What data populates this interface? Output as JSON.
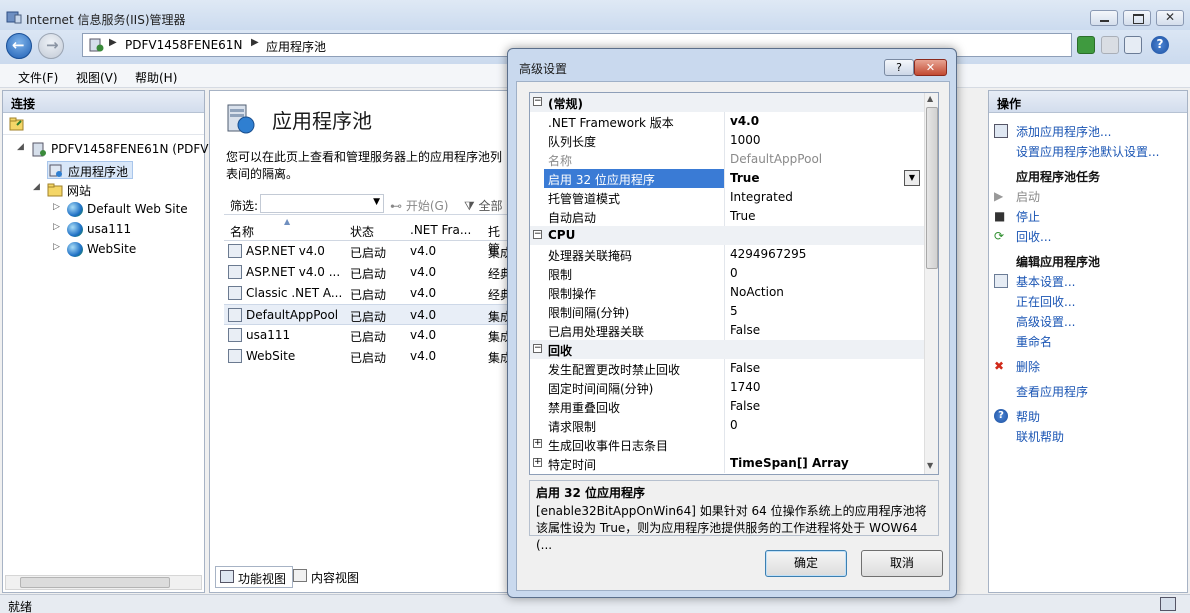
{
  "window": {
    "title": "Internet 信息服务(IIS)管理器"
  },
  "address": {
    "crumbs": [
      "PDFV1458FENE61N",
      "应用程序池"
    ]
  },
  "menu": [
    "文件(F)",
    "视图(V)",
    "帮助(H)"
  ],
  "connections": {
    "header": "连接",
    "tree": [
      {
        "label": "PDFV1458FENE61N (PDFV1",
        "level": 0
      },
      {
        "label": "应用程序池",
        "level": 1,
        "selected": true
      },
      {
        "label": "网站",
        "level": 1
      },
      {
        "label": "Default Web Site",
        "level": 2
      },
      {
        "label": "usa111",
        "level": 2
      },
      {
        "label": "WebSite",
        "level": 2
      }
    ]
  },
  "main": {
    "title": "应用程序池",
    "description": "您可以在此页上查看和管理服务器上的应用程序池列表间的隔离。",
    "filter_label": "筛选:",
    "start_label": "开始(G)",
    "all_label": "全部",
    "columns": [
      "名称",
      "状态",
      ".NET Fra...",
      "托管"
    ],
    "rows": [
      {
        "name": "ASP.NET v4.0",
        "status": "已启动",
        "net": "v4.0",
        "mode": "集成"
      },
      {
        "name": "ASP.NET v4.0 ...",
        "status": "已启动",
        "net": "v4.0",
        "mode": "经典"
      },
      {
        "name": "Classic .NET A...",
        "status": "已启动",
        "net": "v4.0",
        "mode": "经典"
      },
      {
        "name": "DefaultAppPool",
        "status": "已启动",
        "net": "v4.0",
        "mode": "集成",
        "selected": true
      },
      {
        "name": "usa111",
        "status": "已启动",
        "net": "v4.0",
        "mode": "集成"
      },
      {
        "name": "WebSite",
        "status": "已启动",
        "net": "v4.0",
        "mode": "集成"
      }
    ],
    "view_tabs": [
      "功能视图",
      "内容视图"
    ]
  },
  "actions": {
    "header": "操作",
    "items": [
      {
        "label": "添加应用程序池...",
        "kind": "link",
        "icon": "add-pool-icon"
      },
      {
        "label": "设置应用程序池默认设置...",
        "kind": "link"
      },
      {
        "label": "应用程序池任务",
        "kind": "head"
      },
      {
        "label": "启动",
        "kind": "dis",
        "icon": "play-icon"
      },
      {
        "label": "停止",
        "kind": "link",
        "icon": "stop-icon"
      },
      {
        "label": "回收...",
        "kind": "link",
        "icon": "recycle-icon"
      },
      {
        "label": "编辑应用程序池",
        "kind": "head"
      },
      {
        "label": "基本设置...",
        "kind": "link",
        "icon": "settings-icon"
      },
      {
        "label": "正在回收...",
        "kind": "link"
      },
      {
        "label": "高级设置...",
        "kind": "link"
      },
      {
        "label": "重命名",
        "kind": "link"
      },
      {
        "label": "删除",
        "kind": "link",
        "icon": "delete-icon"
      },
      {
        "label": "查看应用程序",
        "kind": "link"
      },
      {
        "label": "帮助",
        "kind": "link",
        "icon": "help-icon"
      },
      {
        "label": "联机帮助",
        "kind": "link"
      }
    ]
  },
  "status": "就绪",
  "dialog": {
    "title": "高级设置",
    "properties": [
      {
        "type": "cat",
        "key": "(常规)",
        "toggle": "⊟"
      },
      {
        "key": ".NET Framework 版本",
        "value": "v4.0",
        "bold": true
      },
      {
        "key": "队列长度",
        "value": "1000"
      },
      {
        "key": "名称",
        "value": "DefaultAppPool",
        "dim": true
      },
      {
        "key": "启用 32 位应用程序",
        "value": "True",
        "bold": true,
        "selected": true
      },
      {
        "key": "托管管道模式",
        "value": "Integrated"
      },
      {
        "key": "自动启动",
        "value": "True"
      },
      {
        "type": "cat",
        "key": "CPU",
        "toggle": "⊟"
      },
      {
        "key": "处理器关联掩码",
        "value": "4294967295"
      },
      {
        "key": "限制",
        "value": "0"
      },
      {
        "key": "限制操作",
        "value": "NoAction"
      },
      {
        "key": "限制间隔(分钟)",
        "value": "5"
      },
      {
        "key": "已启用处理器关联",
        "value": "False"
      },
      {
        "type": "cat",
        "key": "回收",
        "toggle": "⊟"
      },
      {
        "key": "发生配置更改时禁止回收",
        "value": "False"
      },
      {
        "key": "固定时间间隔(分钟)",
        "value": "1740"
      },
      {
        "key": "禁用重叠回收",
        "value": "False"
      },
      {
        "key": "请求限制",
        "value": "0"
      },
      {
        "key": "生成回收事件日志条目",
        "value": "",
        "toggle": "⊞"
      },
      {
        "key": "特定时间",
        "value": "TimeSpan[] Array",
        "bold": true,
        "toggle": "⊞"
      }
    ],
    "desc_title": "启用 32 位应用程序",
    "desc_text": "[enable32BitAppOnWin64] 如果针对 64 位操作系统上的应用程序池将该属性设为 True，则为应用程序池提供服务的工作进程将处于 WOW64 (...",
    "ok": "确定",
    "cancel": "取消"
  }
}
